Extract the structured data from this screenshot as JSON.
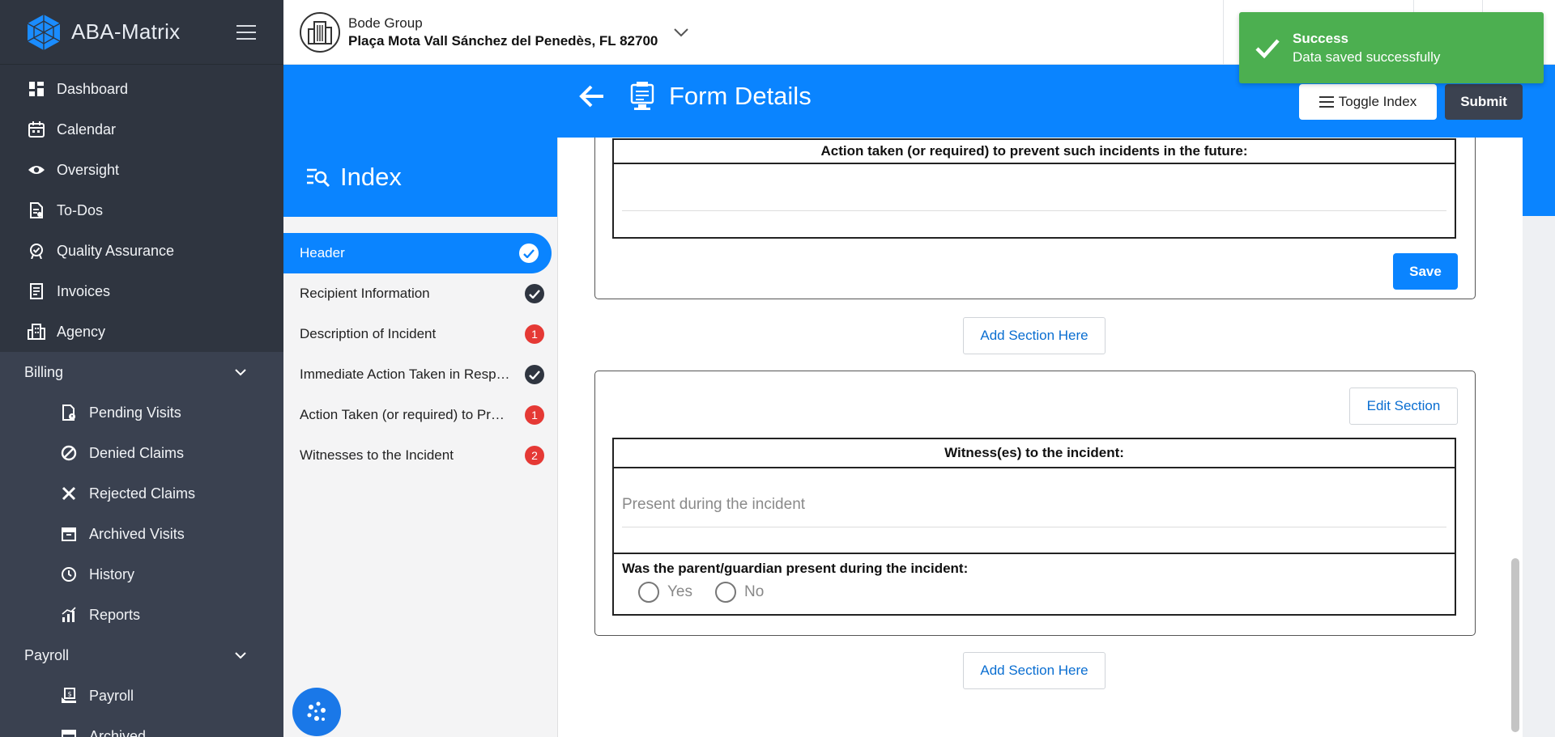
{
  "app": {
    "name": "ABA-Matrix"
  },
  "sidebar": {
    "items": [
      {
        "label": "Dashboard",
        "icon": "dashboard-icon"
      },
      {
        "label": "Calendar",
        "icon": "calendar-icon"
      },
      {
        "label": "Oversight",
        "icon": "eye-icon"
      },
      {
        "label": "To-Dos",
        "icon": "todo-icon"
      },
      {
        "label": "Quality Assurance",
        "icon": "quality-icon"
      },
      {
        "label": "Invoices",
        "icon": "invoice-icon"
      },
      {
        "label": "Agency",
        "icon": "agency-icon"
      }
    ],
    "billing": {
      "label": "Billing",
      "items": [
        {
          "label": "Pending Visits",
          "icon": "pending-icon"
        },
        {
          "label": "Denied Claims",
          "icon": "denied-icon"
        },
        {
          "label": "Rejected Claims",
          "icon": "rejected-icon"
        },
        {
          "label": "Archived Visits",
          "icon": "archive-icon"
        },
        {
          "label": "History",
          "icon": "history-icon"
        },
        {
          "label": "Reports",
          "icon": "reports-icon"
        }
      ]
    },
    "payroll": {
      "label": "Payroll",
      "items": [
        {
          "label": "Payroll",
          "icon": "payroll-icon"
        },
        {
          "label": "Archived",
          "icon": "archive-icon"
        }
      ]
    }
  },
  "org": {
    "name": "Bode Group",
    "address": "Plaça Mota Vall Sánchez del Penedès, FL 82700"
  },
  "header": {
    "title": "Form Details",
    "toggle_label": "Toggle Index",
    "submit_label": "Submit"
  },
  "index": {
    "title": "Index",
    "items": [
      {
        "label": "Header",
        "status": "complete",
        "active": true
      },
      {
        "label": "Recipient Information",
        "status": "complete"
      },
      {
        "label": "Description of Incident",
        "status": "errors",
        "count": "1"
      },
      {
        "label": "Immediate Action Taken in Response to the Incident",
        "status": "complete"
      },
      {
        "label": "Action Taken (or required) to Prevent Such Incidents in the Future",
        "status": "errors",
        "count": "1"
      },
      {
        "label": "Witnesses to the Incident",
        "status": "errors",
        "count": "2"
      }
    ]
  },
  "sections": {
    "prevent": {
      "heading": "Action taken (or required) to prevent such incidents in the future:",
      "save_label": "Save"
    },
    "add_section_label": "Add Section Here",
    "witness": {
      "edit_label": "Edit Section",
      "heading": "Witness(es) to the incident:",
      "placeholder": "Present during the incident",
      "parent_question": "Was the parent/guardian present during the incident:",
      "options": [
        "Yes",
        "No"
      ]
    }
  },
  "toast": {
    "title": "Success",
    "message": "Data saved successfully",
    "color": "#4caf50"
  },
  "colors": {
    "accent": "#0a84ff",
    "sidebar": "#2f3540",
    "error": "#e53935"
  }
}
